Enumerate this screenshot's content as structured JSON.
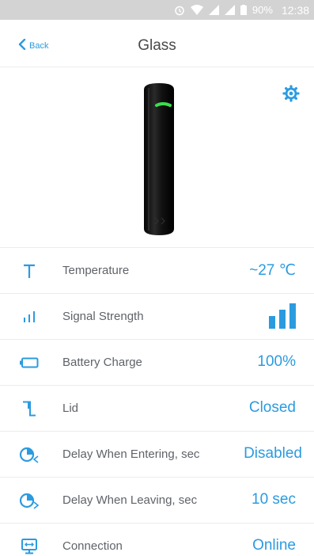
{
  "statusbar": {
    "battery": "90%",
    "time": "12:38"
  },
  "nav": {
    "back_label": "Back",
    "title": "Glass"
  },
  "colors": {
    "accent": "#2b9be0",
    "led": "#3ddc4c"
  },
  "rows": [
    {
      "icon": "temperature-icon",
      "label": "Temperature",
      "value": "~27 ℃"
    },
    {
      "icon": "signal-strength-icon",
      "label": "Signal Strength",
      "value": "",
      "signal_bars": 3
    },
    {
      "icon": "battery-icon",
      "label": "Battery Charge",
      "value": "100%"
    },
    {
      "icon": "lid-icon",
      "label": "Lid",
      "value": "Closed"
    },
    {
      "icon": "delay-entering-icon",
      "label": "Delay When Entering, sec",
      "value": "Disabled"
    },
    {
      "icon": "delay-leaving-icon",
      "label": "Delay When Leaving, sec",
      "value": "10 sec"
    },
    {
      "icon": "connection-icon",
      "label": "Connection",
      "value": "Online"
    }
  ]
}
